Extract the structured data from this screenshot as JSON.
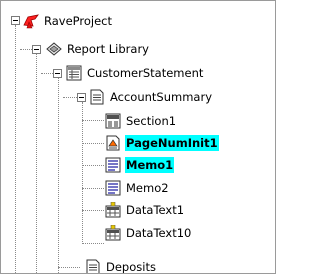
{
  "tree": {
    "root": {
      "label": "RaveProject"
    },
    "report_library": {
      "label": "Report Library"
    },
    "customer_statement": {
      "label": "CustomerStatement"
    },
    "account_summary": {
      "label": "AccountSummary"
    },
    "children": [
      {
        "label": "Section1",
        "icon": "section-icon"
      },
      {
        "label": "PageNumInit1",
        "icon": "page-num-init-icon"
      },
      {
        "label": "Memo1",
        "icon": "memo-icon"
      },
      {
        "label": "Memo2",
        "icon": "memo-icon"
      },
      {
        "label": "DataText1",
        "icon": "data-text-icon"
      },
      {
        "label": "DataText10",
        "icon": "data-text-icon"
      }
    ],
    "deposits": {
      "label": "Deposits"
    }
  },
  "colors": {
    "highlight": "#00ffff"
  }
}
